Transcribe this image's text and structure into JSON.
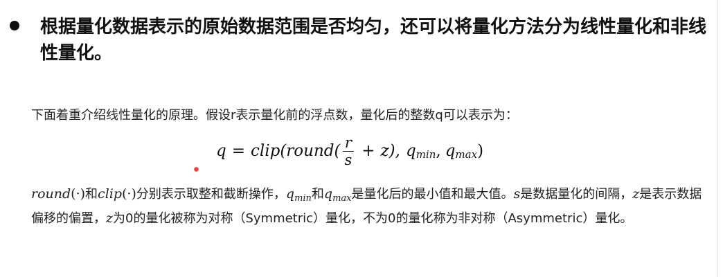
{
  "bullet": {
    "text": "根据量化数据表示的原始数据范围是否均匀，还可以将量化方法分为线性量化和非线性量化。"
  },
  "intro": {
    "text": "下面着重介绍线性量化的原理。假设r表示量化前的浮点数，量化后的整数q可以表示为："
  },
  "formula": {
    "lhs": "q",
    "equals": "=",
    "func": "clip(round(",
    "numerator": "r",
    "denominator": "s",
    "plus": "+",
    "z_close": "z),",
    "q1": "q",
    "q1_sub": "min",
    "comma": ",",
    "q2": "q",
    "q2_sub": "max",
    "close": ")"
  },
  "explain": {
    "round": "round",
    "round_arg": "(·)",
    "he1": "和",
    "clip": "clip",
    "clip_arg": "(·)",
    "t1": "分别表示取整和截断操作，",
    "qmin": "q",
    "qmin_sub": "min",
    "he2": "和",
    "qmax": "q",
    "qmax_sub": "max",
    "t2": "是量化后的最小值和最大值。",
    "s": "s",
    "t3": "是数据量化的间隔，",
    "z1": "z",
    "t4": "是表示数据偏移的偏置，",
    "z2": "z",
    "t5": "为0的量化被称为对称（Symmetric）量化，不为0的量化称为非对称（Asymmetric）量化。"
  }
}
